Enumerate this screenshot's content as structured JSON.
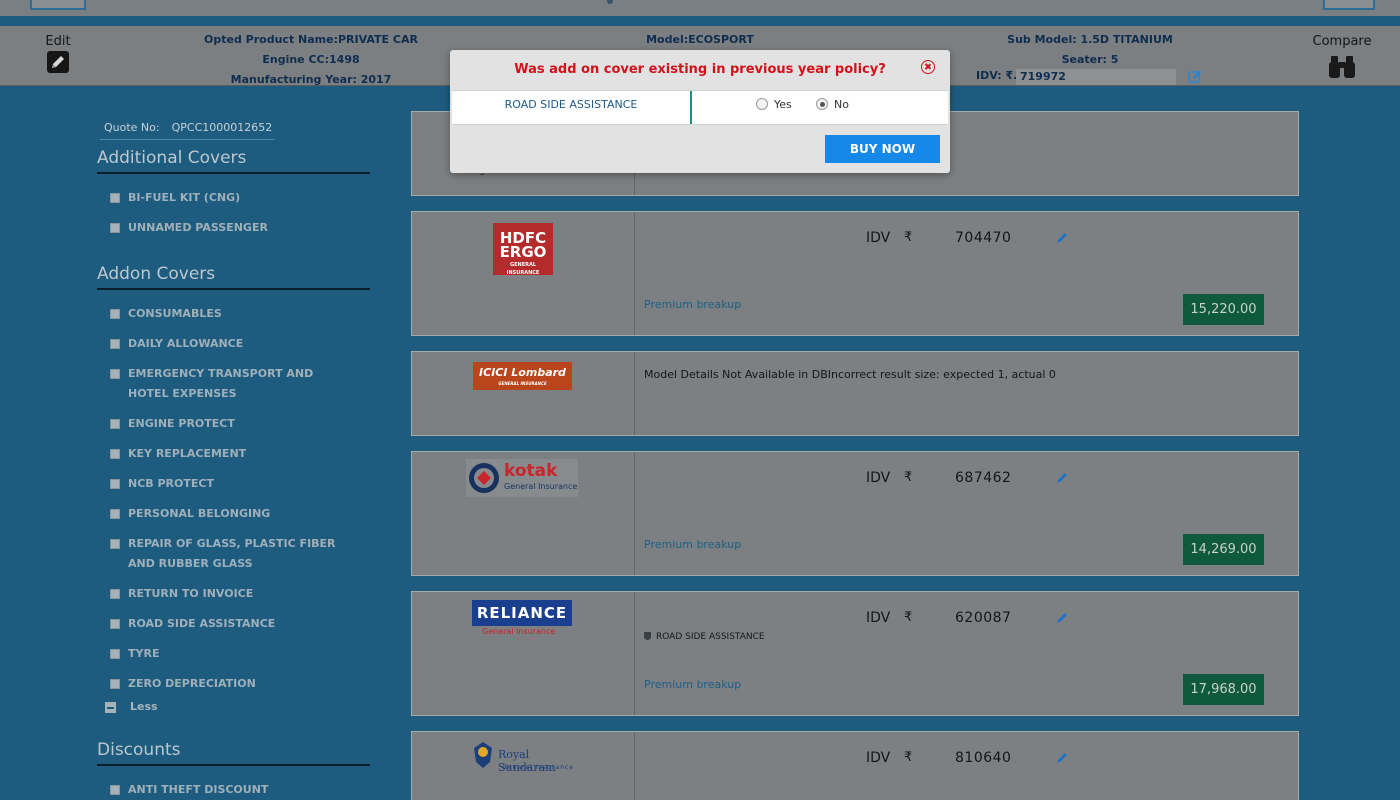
{
  "infobar": {
    "edit_label": "Edit",
    "compare_label": "Compare",
    "product_name": "Opted Product Name:PRIVATE CAR",
    "engine_cc": "Engine CC:1498",
    "manufacturing_year": "Manufacturing Year: 2017",
    "model": "Model:ECOSPORT",
    "sub_model": "Sub Model: 1.5D TITANIUM",
    "seater": "Seater: 5",
    "idv_label": "IDV: ₹.",
    "idv_value": "719972"
  },
  "sidebar": {
    "quote_label": "Quote No:",
    "quote_value": "QPCC1000012652",
    "additional_covers_title": "Additional Covers",
    "additional_covers": [
      "BI-FUEL KIT (CNG)",
      "UNNAMED PASSENGER"
    ],
    "addon_covers_title": "Addon Covers",
    "addon_covers": [
      "CONSUMABLES",
      "DAILY ALLOWANCE",
      "EMERGENCY TRANSPORT AND HOTEL EXPENSES",
      "ENGINE PROTECT",
      "KEY REPLACEMENT",
      "NCB PROTECT",
      "PERSONAL BELONGING",
      "REPAIR OF GLASS, PLASTIC FIBER AND RUBBER GLASS",
      "RETURN TO INVOICE",
      "ROAD SIDE ASSISTANCE",
      "TYRE",
      "ZERO DEPRECIATION"
    ],
    "less_label": "Less",
    "discounts_title": "Discounts",
    "discounts": [
      "ANTI THEFT DISCOUNT"
    ]
  },
  "cards": {
    "first_partial_text": "general insurance",
    "hdfc": {
      "logo_line1": "HDFC",
      "logo_line2": "ERGO",
      "logo_sub": "GENERAL INSURANCE",
      "idv_label": "IDV",
      "rupee": "₹",
      "idv": "704470",
      "premium_link": "Premium breakup",
      "price": "15,220.00"
    },
    "icici": {
      "logo_text": "ICICI Lombard",
      "logo_sub": "GENERAL INSURANCE",
      "message": "Model Details Not Available in DBIncorrect result size: expected 1, actual 0"
    },
    "kotak": {
      "logo_text": "kotak",
      "logo_sub": "General Insurance",
      "idv_label": "IDV",
      "rupee": "₹",
      "idv": "687462",
      "premium_link": "Premium breakup",
      "price": "14,269.00"
    },
    "reliance": {
      "logo_text": "RELIANCE",
      "logo_sub": "General Insurance",
      "idv_label": "IDV",
      "rupee": "₹",
      "idv": "620087",
      "addon": "ROAD SIDE ASSISTANCE",
      "premium_link": "Premium breakup",
      "price": "17,968.00"
    },
    "royal": {
      "logo_text": "Royal Sundaram",
      "logo_sub": "General Insurance",
      "idv_label": "IDV",
      "rupee": "₹",
      "idv": "810640"
    }
  },
  "modal": {
    "title": "Was add on cover existing in previous year policy?",
    "cover_name": "ROAD SIDE ASSISTANCE",
    "yes_label": "Yes",
    "no_label": "No",
    "selected": "No",
    "buy_label": "BUY NOW"
  },
  "colors": {
    "background": "#1d5c7e",
    "price_button": "#0f5a3f",
    "buy_button": "#1588e9",
    "modal_title": "#d3111b"
  }
}
